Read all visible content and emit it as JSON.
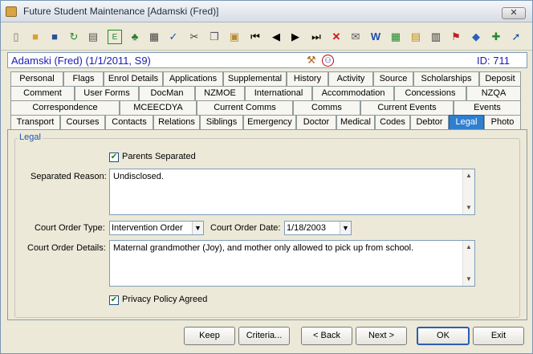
{
  "window": {
    "title": "Future Student Maintenance  [Adamski (Fred)]",
    "close_symbol": "✕"
  },
  "toolbar": {
    "icons": [
      "new-document-icon",
      "open-folder-icon",
      "save-disk-icon",
      "refresh-icon",
      "print-icon",
      "edit-icon",
      "tree-icon",
      "calculator-icon",
      "spellcheck-icon",
      "cut-icon",
      "copy-icon",
      "paste-icon",
      "first-record-icon",
      "previous-record-icon",
      "next-record-icon",
      "last-record-icon",
      "delete-icon",
      "email-icon",
      "word-icon",
      "spreadsheet-icon",
      "notes-icon",
      "calendar-icon",
      "flag-icon",
      "tag-icon",
      "add-record-icon",
      "go-arrow-icon"
    ]
  },
  "info": {
    "student": "Adamski (Fred) (1/1/2011, S9)",
    "id_text": "ID: 711"
  },
  "tabs": {
    "rows": [
      [
        "Personal",
        "Flags",
        "Enrol Details",
        "Applications",
        "Supplemental",
        "History",
        "Activity",
        "Source",
        "Scholarships",
        "Deposit"
      ],
      [
        "Comment",
        "User Forms",
        "DocMan",
        "NZMOE",
        "International",
        "Accommodation",
        "Concessions",
        "NZQA"
      ],
      [
        "Correspondence",
        "MCEECDYA",
        "Current Comms",
        "Comms",
        "Current Events",
        "Events"
      ],
      [
        "Transport",
        "Courses",
        "Contacts",
        "Relations",
        "Siblings",
        "Emergency",
        "Doctor",
        "Medical",
        "Codes",
        "Debtor",
        "Legal",
        "Photo"
      ]
    ],
    "active": "Legal"
  },
  "legal": {
    "group_title": "Legal",
    "parents_separated": {
      "label": "Parents Separated",
      "checked": true
    },
    "separated_reason": {
      "label": "Separated Reason:",
      "value": "Undisclosed."
    },
    "court_order_type": {
      "label": "Court Order Type:",
      "value": "Intervention Order"
    },
    "court_order_date": {
      "label": "Court Order Date:",
      "value": "1/18/2003"
    },
    "court_order_details": {
      "label": "Court Order Details:",
      "value": "Maternal grandmother (Joy), and mother only allowed to pick up from school."
    },
    "privacy_policy": {
      "label": "Privacy Policy Agreed",
      "checked": true
    }
  },
  "buttons": {
    "keep": {
      "label": "Keep",
      "accel": "K"
    },
    "criteria": {
      "label": "Criteria...",
      "accel": "C"
    },
    "back": {
      "label": "< Back",
      "accel": "B"
    },
    "next": {
      "label": "Next >",
      "accel": "N"
    },
    "ok": {
      "label": "OK",
      "accel": "O"
    },
    "exit": {
      "label": "Exit",
      "accel": "x"
    }
  }
}
